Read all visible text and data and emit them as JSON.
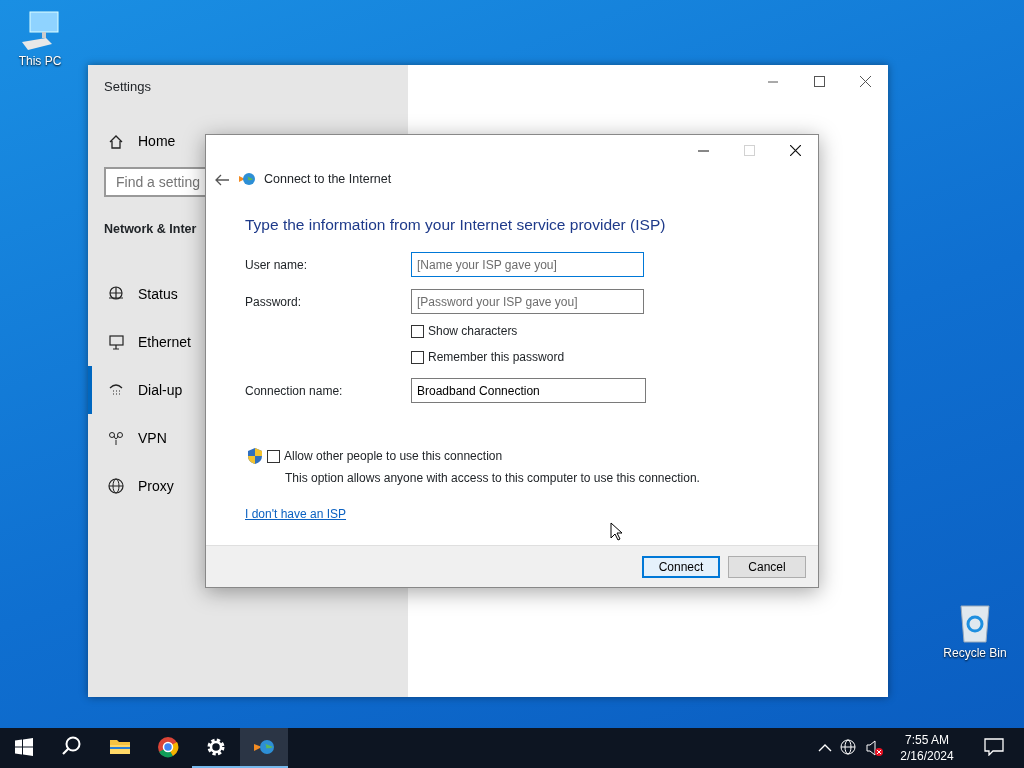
{
  "desktop_icons": [
    {
      "kind": "computer",
      "label": "This PC"
    },
    {
      "kind": "recycle",
      "label": "Recycle Bin"
    }
  ],
  "settings_window": {
    "title": "Settings",
    "home": "Home",
    "search": {
      "placeholder": "Find a setting"
    },
    "section": "Network & Inter",
    "nav": [
      {
        "label": "Status",
        "selected": false
      },
      {
        "label": "Ethernet",
        "selected": false
      },
      {
        "label": "Dial-up",
        "selected": true
      },
      {
        "label": "VPN",
        "selected": false
      },
      {
        "label": "Proxy",
        "selected": false
      }
    ]
  },
  "dialog": {
    "title": "Connect to the Internet",
    "heading": "Type the information from your Internet service provider (ISP)",
    "fields": [
      {
        "label": "User name:",
        "placeholder": "[Name your ISP gave you]",
        "focused": true
      },
      {
        "label": "Password:",
        "placeholder": "[Password your ISP gave you]",
        "focused": false
      }
    ],
    "options": [
      {
        "label": "Show characters",
        "checked": false
      },
      {
        "label": "Remember this password",
        "checked": false
      }
    ],
    "connection_name": {
      "label": "Connection name:",
      "value": "Broadband Connection"
    },
    "allow_others": {
      "label": "Allow other people to use this connection",
      "checked": false,
      "description": "This option allows anyone with access to this computer to use this connection."
    },
    "link": "I don't have an ISP",
    "buttons": [
      {
        "label": "Connect",
        "default": true
      },
      {
        "label": "Cancel",
        "default": false
      }
    ]
  },
  "taskbar": {
    "apps": [
      {
        "kind": "search",
        "active": false
      },
      {
        "kind": "folder",
        "active": false
      },
      {
        "kind": "browser",
        "active": false
      },
      {
        "kind": "gear",
        "active": true
      },
      {
        "kind": "network",
        "active": true
      }
    ],
    "time": "7:55 AM",
    "date": "2/16/2024"
  }
}
